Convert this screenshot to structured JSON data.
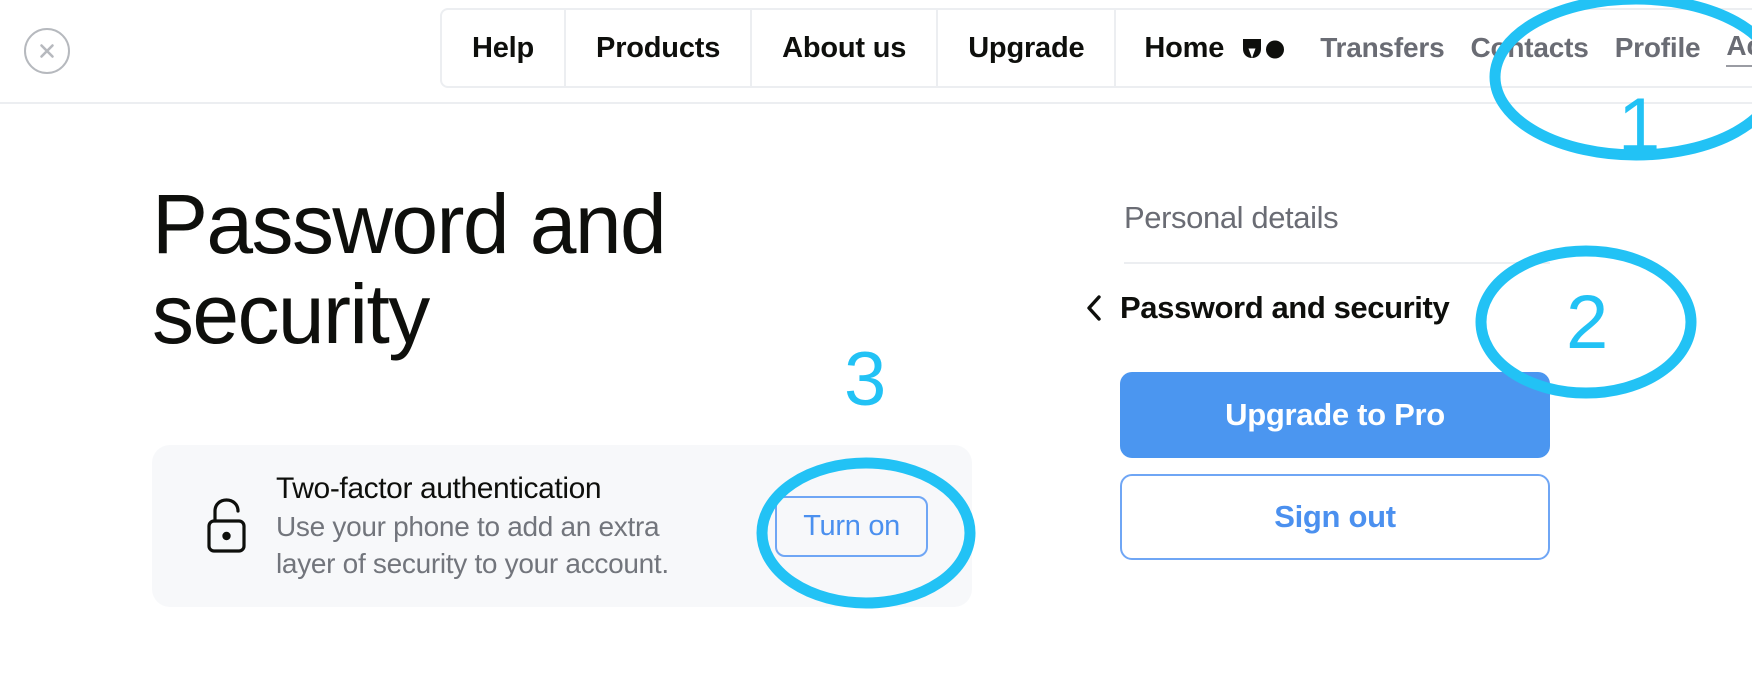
{
  "window": {
    "close_icon": "close-circle-icon"
  },
  "nav": {
    "primary": [
      {
        "label": "Help"
      },
      {
        "label": "Products"
      },
      {
        "label": "About us"
      },
      {
        "label": "Upgrade"
      }
    ],
    "home_label": "Home",
    "brand_icon": "wise-logo-icon",
    "links": [
      {
        "label": "Transfers",
        "active": false
      },
      {
        "label": "Contacts",
        "active": false
      },
      {
        "label": "Profile",
        "active": false
      },
      {
        "label": "Account",
        "active": true
      }
    ]
  },
  "main": {
    "page_title": "Password and security",
    "two_factor": {
      "icon": "unlocked-padlock-icon",
      "title": "Two-factor authentication",
      "description": "Use your phone to add an extra layer of security to your account.",
      "action_label": "Turn on"
    }
  },
  "rail": {
    "personal_details_label": "Personal details",
    "back_icon": "chevron-left-icon",
    "password_security_label": "Password and security",
    "upgrade_label": "Upgrade to Pro",
    "signout_label": "Sign out"
  },
  "annotations": {
    "color": "#22c2f5",
    "markers": [
      {
        "number": "1",
        "target": "nav-link-account"
      },
      {
        "number": "2",
        "target": "rail-password-and-security"
      },
      {
        "number": "3",
        "target": "turn-on-button"
      }
    ]
  },
  "colors": {
    "accent_blue": "#4b96f0",
    "annotation_cyan": "#22c2f5",
    "card_background": "#f7f8fa",
    "text_primary": "#0e0f0c",
    "text_muted": "#6a6c74",
    "border": "#eceef1"
  }
}
